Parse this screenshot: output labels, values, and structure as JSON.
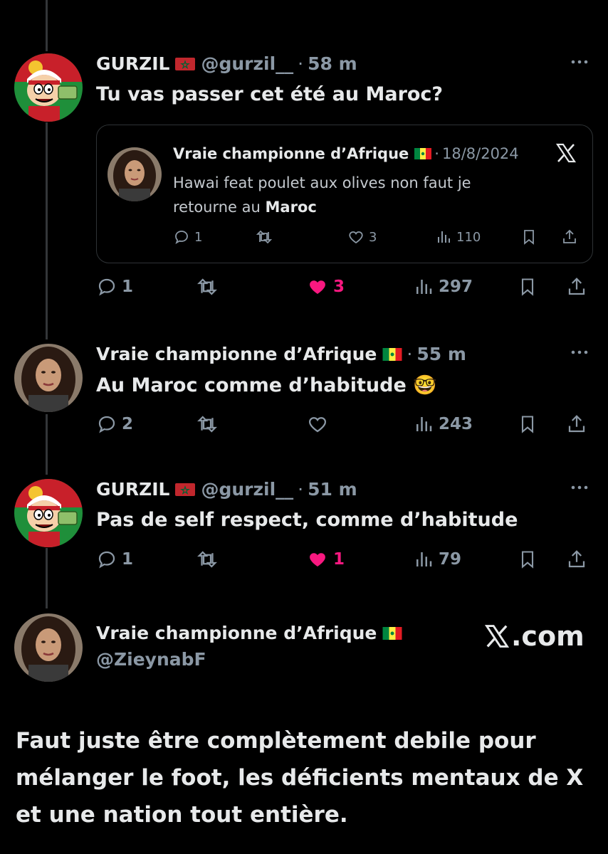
{
  "tweets": [
    {
      "name": "GURZIL",
      "handle": "@gurzil__",
      "time": "58 m",
      "flag": "morocco",
      "text": "Tu vas passer cet été au Maroc?",
      "stats": {
        "replies": "1",
        "likes": "3",
        "views": "297",
        "liked": true
      }
    },
    {
      "name": "Vraie championne d’Afrique",
      "time": "55 m",
      "flag": "senegal",
      "text": "Au Maroc comme d’habitude 🤓",
      "stats": {
        "replies": "2",
        "likes": "",
        "views": "243",
        "liked": false
      }
    },
    {
      "name": "GURZIL",
      "handle": "@gurzil__",
      "time": "51 m",
      "flag": "morocco",
      "text": "Pas de self respect, comme d’habitude",
      "stats": {
        "replies": "1",
        "likes": "1",
        "views": "79",
        "liked": true
      }
    }
  ],
  "quote": {
    "name": "Vraie championne d’Afrique",
    "flag": "senegal",
    "date": "18/8/2024",
    "text_line1": "Hawai feat poulet aux olives non faut je",
    "text_line2_prefix": "retourne au ",
    "text_line2_bold": "Maroc",
    "stats": {
      "replies": "1",
      "likes": "3",
      "views": "110"
    }
  },
  "final": {
    "name": "Vraie championne d’Afrique",
    "handle": "@ZieynabF",
    "brand": ".com",
    "body": "Faut juste être complètement debile pour mélanger le foot, les déficients mentaux de X et une nation tout entière."
  },
  "separator": "·",
  "colors": {
    "background": "#000000",
    "text": "#e7e9ea",
    "muted": "#8b98a5",
    "like": "#f91880",
    "border": "#2f3336"
  },
  "icons": [
    "reply-icon",
    "retweet-icon",
    "like-icon",
    "views-icon",
    "bookmark-icon",
    "share-icon",
    "more-icon",
    "x-logo-icon"
  ]
}
